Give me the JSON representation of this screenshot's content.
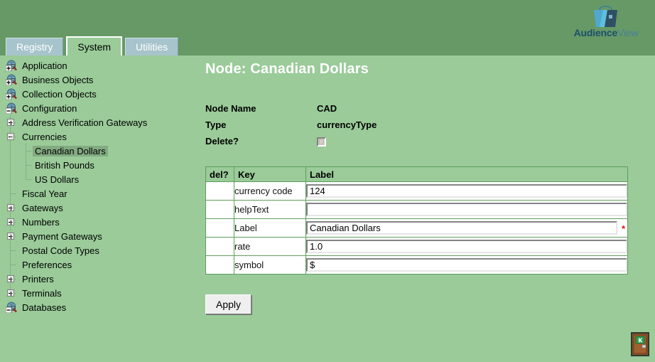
{
  "brand": {
    "name_bold": "Audience",
    "name_light": "View",
    "logo_icon": "shopping-bag-logo",
    "colors": {
      "accent_light": "#4fa8cf",
      "accent_dark": "#2f4f63"
    }
  },
  "theme": {
    "page_bg": "#9acb99",
    "band_bg": "#669966",
    "tab_inactive_bg": "#a7c4cc",
    "tab_active_bg": "#9acb99",
    "table_border": "#5f9e5c",
    "selection_bg": "#83ab82",
    "required_star": "#dd1111",
    "title_color": "#ffffff"
  },
  "tabs": [
    {
      "label": "Registry",
      "active": false
    },
    {
      "label": "System",
      "active": true
    },
    {
      "label": "Utilities",
      "active": false
    }
  ],
  "tree": [
    {
      "label": "Application",
      "icon": "globe-plus-icon",
      "depth": 0,
      "state": "collapsed",
      "selected": false
    },
    {
      "label": "Business Objects",
      "icon": "globe-plus-icon",
      "depth": 0,
      "state": "collapsed",
      "selected": false
    },
    {
      "label": "Collection Objects",
      "icon": "globe-plus-icon",
      "depth": 0,
      "state": "collapsed",
      "selected": false
    },
    {
      "label": "Configuration",
      "icon": "globe-minus-icon",
      "depth": 0,
      "state": "expanded",
      "selected": false
    },
    {
      "label": "Address Verification Gateways",
      "icon": "plus-box-icon",
      "depth": 1,
      "state": "collapsed",
      "selected": false
    },
    {
      "label": "Currencies",
      "icon": "minus-box-icon",
      "depth": 1,
      "state": "expanded",
      "selected": false
    },
    {
      "label": "Canadian Dollars",
      "icon": "leaf-node-icon",
      "depth": 2,
      "state": "leaf",
      "selected": true
    },
    {
      "label": "British Pounds",
      "icon": "leaf-node-icon",
      "depth": 2,
      "state": "leaf",
      "selected": false
    },
    {
      "label": "US Dollars",
      "icon": "leaf-node-icon",
      "depth": 2,
      "state": "leaf",
      "selected": false
    },
    {
      "label": "Fiscal Year",
      "icon": "leaf-node-icon",
      "depth": 1,
      "state": "leaf",
      "selected": false
    },
    {
      "label": "Gateways",
      "icon": "plus-box-icon",
      "depth": 1,
      "state": "collapsed",
      "selected": false
    },
    {
      "label": "Numbers",
      "icon": "plus-box-icon",
      "depth": 1,
      "state": "collapsed",
      "selected": false
    },
    {
      "label": "Payment Gateways",
      "icon": "plus-box-icon",
      "depth": 1,
      "state": "collapsed",
      "selected": false
    },
    {
      "label": "Postal Code Types",
      "icon": "leaf-node-icon",
      "depth": 1,
      "state": "leaf",
      "selected": false
    },
    {
      "label": "Preferences",
      "icon": "leaf-node-icon",
      "depth": 1,
      "state": "leaf",
      "selected": false
    },
    {
      "label": "Printers",
      "icon": "plus-box-icon",
      "depth": 1,
      "state": "collapsed",
      "selected": false
    },
    {
      "label": "Terminals",
      "icon": "plus-box-icon",
      "depth": 1,
      "state": "collapsed",
      "selected": false
    },
    {
      "label": "Databases",
      "icon": "globe-minus-icon",
      "depth": 0,
      "state": "expanded",
      "selected": false
    }
  ],
  "main": {
    "title": "Node: Canadian Dollars",
    "properties": [
      {
        "key": "Node Name",
        "value": "CAD"
      },
      {
        "key": "Type",
        "value": "currencyType"
      },
      {
        "key": "Delete?",
        "value": "",
        "control": "checkbox",
        "checked": false
      }
    ],
    "table": {
      "headers": [
        "del?",
        "Key",
        "Label"
      ],
      "rows": [
        {
          "del": "",
          "key": "currency code",
          "value": "124",
          "placeholder": "",
          "required": false
        },
        {
          "del": "",
          "key": "helpText",
          "value": "",
          "placeholder": "",
          "required": false
        },
        {
          "del": "",
          "key": "Label",
          "value": "Canadian Dollars",
          "placeholder": "",
          "required": true
        },
        {
          "del": "",
          "key": "rate",
          "value": "1.0",
          "placeholder": "",
          "required": false
        },
        {
          "del": "",
          "key": "symbol",
          "value": "$",
          "placeholder": "",
          "required": false
        }
      ]
    },
    "apply_label": "Apply"
  },
  "footer": {
    "exit_icon": "exit-door-icon"
  }
}
